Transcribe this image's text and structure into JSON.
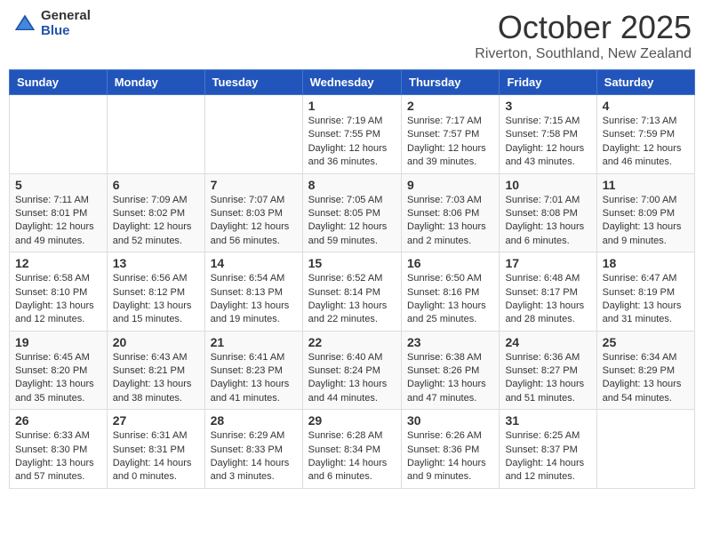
{
  "logo": {
    "general": "General",
    "blue": "Blue"
  },
  "title": "October 2025",
  "location": "Riverton, Southland, New Zealand",
  "days_of_week": [
    "Sunday",
    "Monday",
    "Tuesday",
    "Wednesday",
    "Thursday",
    "Friday",
    "Saturday"
  ],
  "weeks": [
    [
      {
        "day": "",
        "info": ""
      },
      {
        "day": "",
        "info": ""
      },
      {
        "day": "",
        "info": ""
      },
      {
        "day": "1",
        "info": "Sunrise: 7:19 AM\nSunset: 7:55 PM\nDaylight: 12 hours and 36 minutes."
      },
      {
        "day": "2",
        "info": "Sunrise: 7:17 AM\nSunset: 7:57 PM\nDaylight: 12 hours and 39 minutes."
      },
      {
        "day": "3",
        "info": "Sunrise: 7:15 AM\nSunset: 7:58 PM\nDaylight: 12 hours and 43 minutes."
      },
      {
        "day": "4",
        "info": "Sunrise: 7:13 AM\nSunset: 7:59 PM\nDaylight: 12 hours and 46 minutes."
      }
    ],
    [
      {
        "day": "5",
        "info": "Sunrise: 7:11 AM\nSunset: 8:01 PM\nDaylight: 12 hours and 49 minutes."
      },
      {
        "day": "6",
        "info": "Sunrise: 7:09 AM\nSunset: 8:02 PM\nDaylight: 12 hours and 52 minutes."
      },
      {
        "day": "7",
        "info": "Sunrise: 7:07 AM\nSunset: 8:03 PM\nDaylight: 12 hours and 56 minutes."
      },
      {
        "day": "8",
        "info": "Sunrise: 7:05 AM\nSunset: 8:05 PM\nDaylight: 12 hours and 59 minutes."
      },
      {
        "day": "9",
        "info": "Sunrise: 7:03 AM\nSunset: 8:06 PM\nDaylight: 13 hours and 2 minutes."
      },
      {
        "day": "10",
        "info": "Sunrise: 7:01 AM\nSunset: 8:08 PM\nDaylight: 13 hours and 6 minutes."
      },
      {
        "day": "11",
        "info": "Sunrise: 7:00 AM\nSunset: 8:09 PM\nDaylight: 13 hours and 9 minutes."
      }
    ],
    [
      {
        "day": "12",
        "info": "Sunrise: 6:58 AM\nSunset: 8:10 PM\nDaylight: 13 hours and 12 minutes."
      },
      {
        "day": "13",
        "info": "Sunrise: 6:56 AM\nSunset: 8:12 PM\nDaylight: 13 hours and 15 minutes."
      },
      {
        "day": "14",
        "info": "Sunrise: 6:54 AM\nSunset: 8:13 PM\nDaylight: 13 hours and 19 minutes."
      },
      {
        "day": "15",
        "info": "Sunrise: 6:52 AM\nSunset: 8:14 PM\nDaylight: 13 hours and 22 minutes."
      },
      {
        "day": "16",
        "info": "Sunrise: 6:50 AM\nSunset: 8:16 PM\nDaylight: 13 hours and 25 minutes."
      },
      {
        "day": "17",
        "info": "Sunrise: 6:48 AM\nSunset: 8:17 PM\nDaylight: 13 hours and 28 minutes."
      },
      {
        "day": "18",
        "info": "Sunrise: 6:47 AM\nSunset: 8:19 PM\nDaylight: 13 hours and 31 minutes."
      }
    ],
    [
      {
        "day": "19",
        "info": "Sunrise: 6:45 AM\nSunset: 8:20 PM\nDaylight: 13 hours and 35 minutes."
      },
      {
        "day": "20",
        "info": "Sunrise: 6:43 AM\nSunset: 8:21 PM\nDaylight: 13 hours and 38 minutes."
      },
      {
        "day": "21",
        "info": "Sunrise: 6:41 AM\nSunset: 8:23 PM\nDaylight: 13 hours and 41 minutes."
      },
      {
        "day": "22",
        "info": "Sunrise: 6:40 AM\nSunset: 8:24 PM\nDaylight: 13 hours and 44 minutes."
      },
      {
        "day": "23",
        "info": "Sunrise: 6:38 AM\nSunset: 8:26 PM\nDaylight: 13 hours and 47 minutes."
      },
      {
        "day": "24",
        "info": "Sunrise: 6:36 AM\nSunset: 8:27 PM\nDaylight: 13 hours and 51 minutes."
      },
      {
        "day": "25",
        "info": "Sunrise: 6:34 AM\nSunset: 8:29 PM\nDaylight: 13 hours and 54 minutes."
      }
    ],
    [
      {
        "day": "26",
        "info": "Sunrise: 6:33 AM\nSunset: 8:30 PM\nDaylight: 13 hours and 57 minutes."
      },
      {
        "day": "27",
        "info": "Sunrise: 6:31 AM\nSunset: 8:31 PM\nDaylight: 14 hours and 0 minutes."
      },
      {
        "day": "28",
        "info": "Sunrise: 6:29 AM\nSunset: 8:33 PM\nDaylight: 14 hours and 3 minutes."
      },
      {
        "day": "29",
        "info": "Sunrise: 6:28 AM\nSunset: 8:34 PM\nDaylight: 14 hours and 6 minutes."
      },
      {
        "day": "30",
        "info": "Sunrise: 6:26 AM\nSunset: 8:36 PM\nDaylight: 14 hours and 9 minutes."
      },
      {
        "day": "31",
        "info": "Sunrise: 6:25 AM\nSunset: 8:37 PM\nDaylight: 14 hours and 12 minutes."
      },
      {
        "day": "",
        "info": ""
      }
    ]
  ]
}
